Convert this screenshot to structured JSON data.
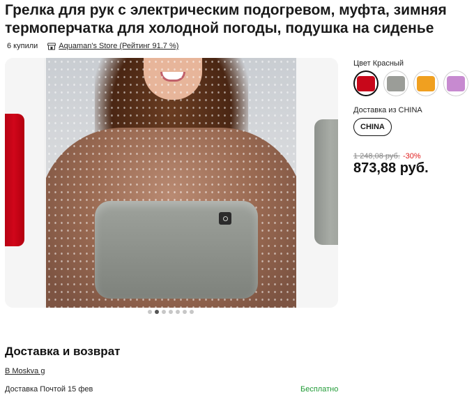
{
  "product": {
    "title": "Грелка для рук с электрическим подогревом, муфта, зимняя термоперчатка для холодной погоды, подушка на сиденье",
    "sold": "6 купили",
    "store": "Aquaman's Store (Рейтинг 91.7 %)"
  },
  "gallery": {
    "slide_count": 7,
    "active_slide": 2
  },
  "options": {
    "color_label": "Цвет Красный",
    "colors": [
      {
        "name": "red",
        "hex": "#c8071a",
        "selected": true
      },
      {
        "name": "gray",
        "hex": "#9b9d98",
        "selected": false
      },
      {
        "name": "orange",
        "hex": "#f0a020",
        "selected": false
      },
      {
        "name": "purple",
        "hex": "#c78ad0",
        "selected": false
      }
    ],
    "shipping_label": "Доставка из CHINA",
    "shipping_option": "CHINA"
  },
  "pricing": {
    "old_price": "1 248,08 руб.",
    "discount": "-30%",
    "price": "873,88 руб."
  },
  "delivery": {
    "title": "Доставка и возврат",
    "city": "В Moskva g",
    "method": "Доставка Почтой 15 фев",
    "cost": "Бесплатно"
  }
}
